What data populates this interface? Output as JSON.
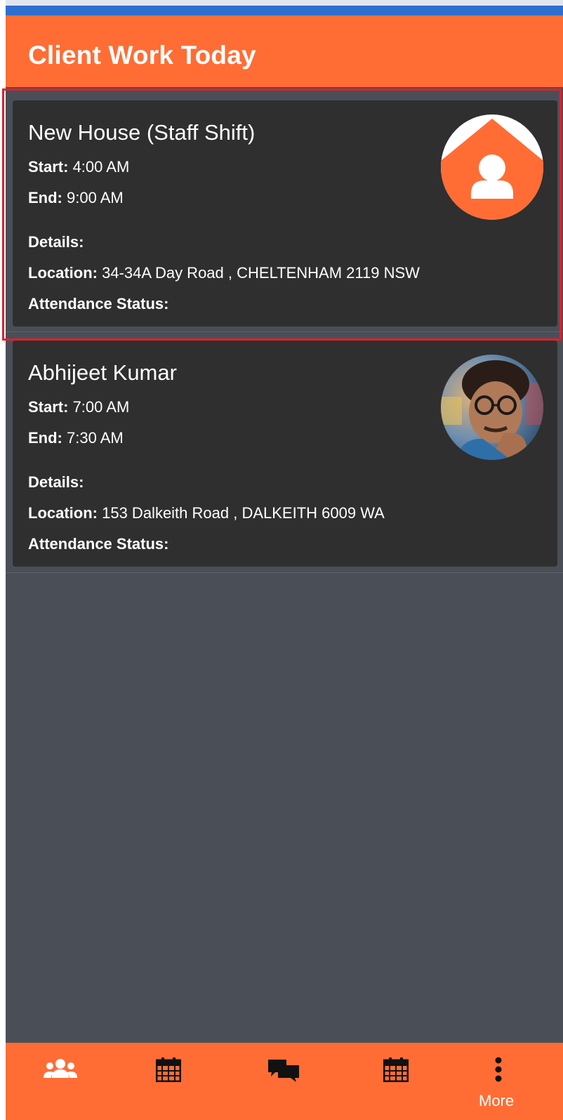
{
  "header": {
    "title": "Client Work Today"
  },
  "cards": [
    {
      "name": "New House (Staff Shift)",
      "start_label": "Start:",
      "start": "4:00 AM",
      "end_label": "End:",
      "end": "9:00 AM",
      "details_label": "Details:",
      "location_label": "Location:",
      "location": "34-34A Day Road , CHELTENHAM 2119 NSW",
      "attendance_label": "Attendance Status:",
      "avatar": "house-user-icon"
    },
    {
      "name": "Abhijeet Kumar",
      "start_label": "Start:",
      "start": "7:00 AM",
      "end_label": "End:",
      "end": "7:30 AM",
      "details_label": "Details:",
      "location_label": "Location:",
      "location": "153 Dalkeith Road , DALKEITH 6009 WA",
      "attendance_label": "Attendance Status:",
      "avatar": "profile-photo"
    }
  ],
  "bottom_nav": {
    "items": [
      {
        "icon": "users-icon"
      },
      {
        "icon": "calendar-icon"
      },
      {
        "icon": "chat-icon"
      },
      {
        "icon": "calendar-icon"
      },
      {
        "icon": "more-vertical-icon",
        "label": "More"
      }
    ]
  },
  "colors": {
    "accent": "#ff6d35",
    "card": "#2f2f2f",
    "background": "#4a4f57",
    "selection": "#e0202c"
  }
}
